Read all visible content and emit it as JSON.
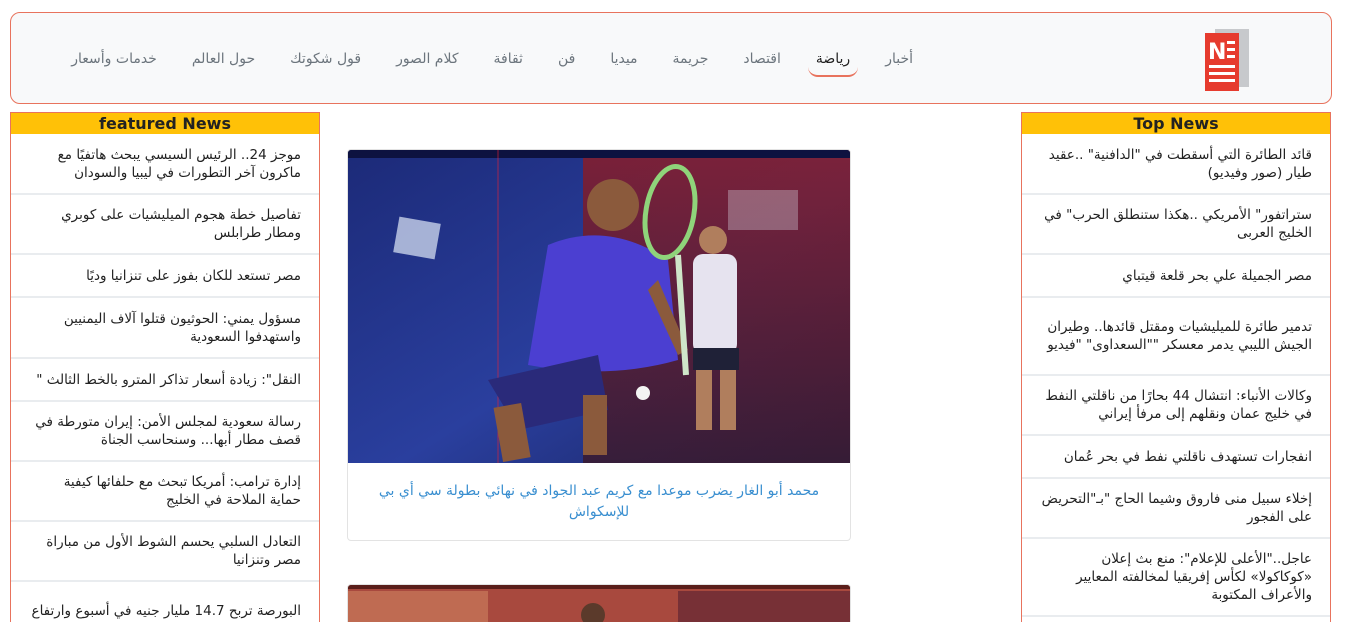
{
  "header": {
    "nav": [
      {
        "label": "أخبار",
        "active": false
      },
      {
        "label": "رياضة",
        "active": true
      },
      {
        "label": "اقتصاد",
        "active": false
      },
      {
        "label": "جريمة",
        "active": false
      },
      {
        "label": "ميديا",
        "active": false
      },
      {
        "label": "فن",
        "active": false
      },
      {
        "label": "ثقافة",
        "active": false
      },
      {
        "label": "كلام الصور",
        "active": false
      },
      {
        "label": "قول شكوتك",
        "active": false
      },
      {
        "label": "حول العالم",
        "active": false
      },
      {
        "label": "خدمات وأسعار",
        "active": false
      }
    ]
  },
  "featured": {
    "title": "featured News",
    "items": [
      "موجز 24.. الرئيس السيسي يبحث هاتفيًا مع ماكرون آخر التطورات في ليبيا والسودان",
      "تفاصيل خطة هجوم الميليشيات على كوبري ومطار طرابلس",
      "مصر تستعد للكان بفوز على تنزانيا وديًا",
      "مسؤول يمني: الحوثيون قتلوا آلاف اليمنيين واستهدفوا السعودية",
      "النقل\": زيادة أسعار تذاكر المترو بالخط الثالث \"",
      "رسالة سعودية لمجلس الأمن: إيران متورطة في قصف مطار أبها... وسنحاسب الجناة",
      "إدارة ترامب: أمريكا تبحث مع حلفائها كيفية حماية الملاحة في الخليج",
      "التعادل السلبي يحسم الشوط الأول من مباراة مصر وتنزانيا",
      "البورصة تربح 14.7 مليار جنيه في أسبوع وارتفاع"
    ]
  },
  "top": {
    "title": "Top News",
    "items": [
      "قائد الطائرة التي أسقطت في \"الدافنية\" ..عقيد طيار (صور وفيديو)",
      "ستراتفور\" الأمريكي ..هكذا ستنطلق الحرب\" في الخليج العربى",
      "مصر الجميلة علي بحر قلعة قيتباي",
      "تدمير طائرة للميليشيات ومقتل قائدها.. وطيران الجيش الليبي يدمر معسكر \"\"السعداوى\" \"فيديو",
      "وكالات الأنباء: انتشال 44 بحارًا من ناقلتي النفط في خليج عمان ونقلهم إلى مرفأ إيراني",
      "انفجارات تستهدف ناقلتي نفط في بحر عُمان",
      "إخلاء سبيل منى فاروق وشيما الحاج \"بـ\"التحريض على الفجور",
      "عاجل..\"الأعلى للإعلام\": منع بث إعلان «كوكاكولا» لكأس إفريقيا لمخالفته المعايير والأعراف المكتوبة"
    ]
  },
  "main": {
    "cards": [
      {
        "caption": "محمد أبو الغار يضرب موعدا مع كريم عبد الجواد في نهائي بطولة سي أي بي للإسكواش",
        "image": "squash-player-photo"
      },
      {
        "caption": "",
        "image": "squash-player-photo"
      }
    ]
  },
  "colors": {
    "accent": "#e8735d",
    "title_bar": "#ffc107",
    "link": "#3a8fd0"
  }
}
